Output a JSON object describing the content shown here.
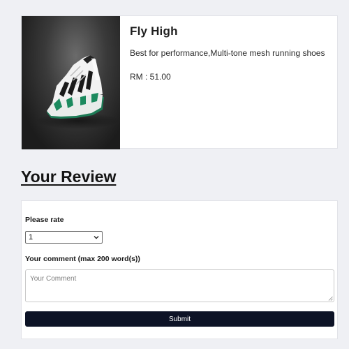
{
  "product": {
    "image_icon": "sneaker-photo",
    "title": "Fly High",
    "description": "Best for performance,Multi-tone mesh running shoes",
    "price": "RM : 51.00"
  },
  "review": {
    "heading": "Your Review",
    "rate_label": "Please rate",
    "rate_selected": "1",
    "comment_label": "Your comment (max 200 word(s))",
    "comment_placeholder": "Your Comment",
    "submit_label": "Submit"
  },
  "colors": {
    "page_background": "#eff0f4",
    "submit_background": "#0d1326"
  }
}
